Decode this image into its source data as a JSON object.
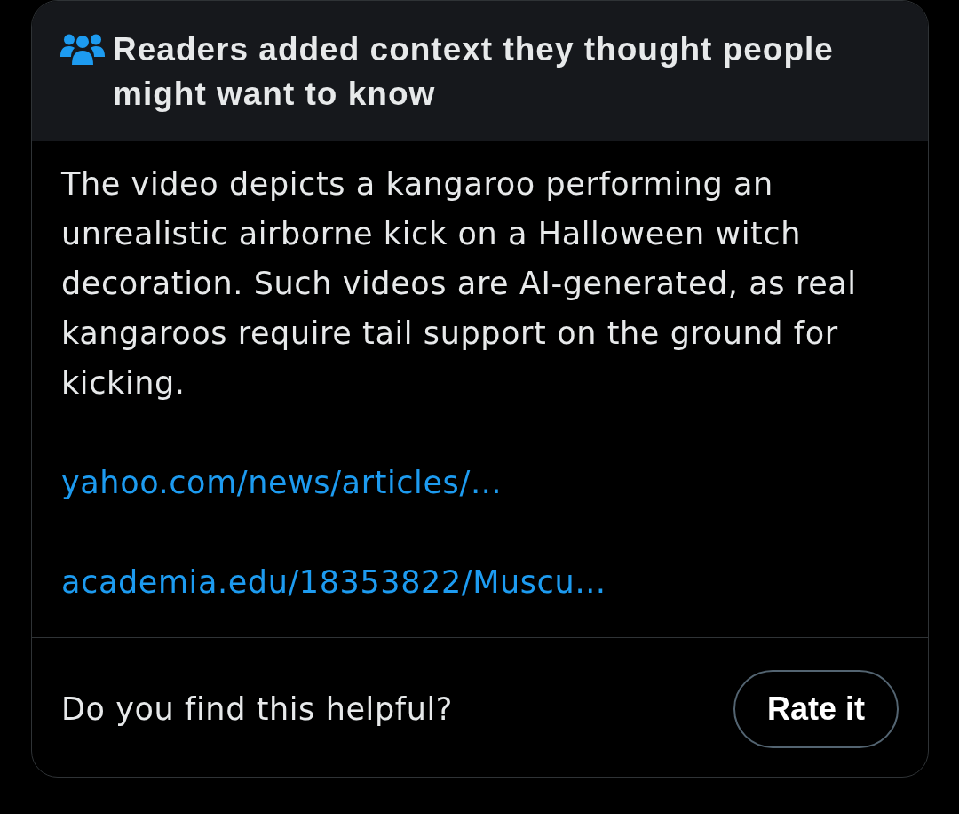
{
  "note": {
    "title": "Readers added context they thought people might want to know",
    "body": "The video depicts a kangaroo performing an unrealistic airborne kick on a Halloween witch decoration. Such videos are AI-generated, as real kangaroos require tail support on the ground for kicking.",
    "links": [
      "yahoo.com/news/articles/…",
      "academia.edu/18353822/Muscu…"
    ]
  },
  "footer": {
    "question": "Do you find this helpful?",
    "button": "Rate it"
  }
}
